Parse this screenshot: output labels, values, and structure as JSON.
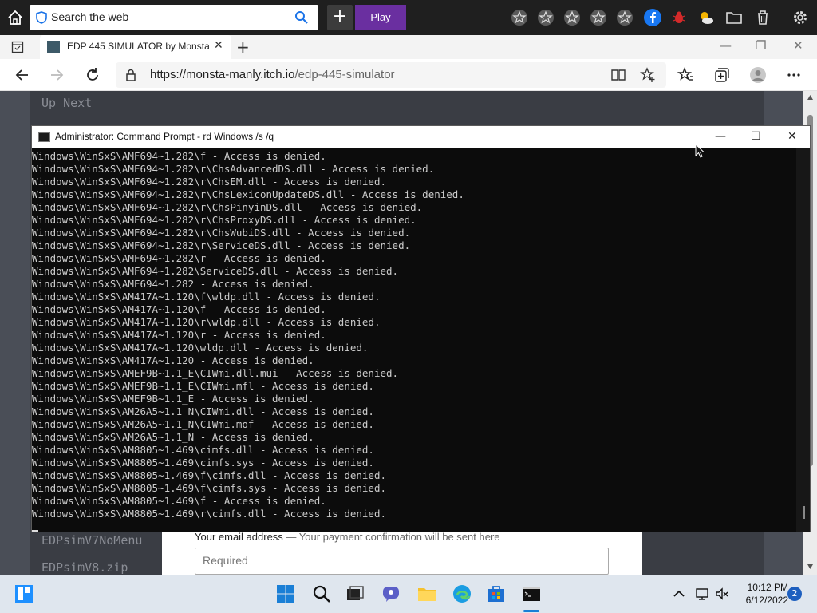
{
  "topbar": {
    "search_placeholder": "Search the web",
    "plus_label": "+",
    "play_label": "Play"
  },
  "browser": {
    "tab_title": "EDP 445 SIMULATOR by Monsta",
    "tab_close": "✕",
    "new_tab": "+",
    "window_minimize": "—",
    "window_restore": "❐",
    "window_close": "✕",
    "url_domain": "https://monsta-manly.itch.io",
    "url_path": "/edp-445-simulator"
  },
  "page": {
    "up_next": "Up Next",
    "file1": "EDPsimV7NoMenu",
    "file2": "EDPsimV8.zip",
    "email_label": "Your email address",
    "email_hint": " — Your payment confirmation will be sent here",
    "email_placeholder": "Required"
  },
  "cmd": {
    "title": "Administrator: Command Prompt - rd  Windows /s /q",
    "minimize": "—",
    "maximize": "☐",
    "close": "✕",
    "lines": [
      "Windows\\WinSxS\\AMF694~1.282\\f - Access is denied.",
      "Windows\\WinSxS\\AMF694~1.282\\r\\ChsAdvancedDS.dll - Access is denied.",
      "Windows\\WinSxS\\AMF694~1.282\\r\\ChsEM.dll - Access is denied.",
      "Windows\\WinSxS\\AMF694~1.282\\r\\ChsLexiconUpdateDS.dll - Access is denied.",
      "Windows\\WinSxS\\AMF694~1.282\\r\\ChsPinyinDS.dll - Access is denied.",
      "Windows\\WinSxS\\AMF694~1.282\\r\\ChsProxyDS.dll - Access is denied.",
      "Windows\\WinSxS\\AMF694~1.282\\r\\ChsWubiDS.dll - Access is denied.",
      "Windows\\WinSxS\\AMF694~1.282\\r\\ServiceDS.dll - Access is denied.",
      "Windows\\WinSxS\\AMF694~1.282\\r - Access is denied.",
      "Windows\\WinSxS\\AMF694~1.282\\ServiceDS.dll - Access is denied.",
      "Windows\\WinSxS\\AMF694~1.282 - Access is denied.",
      "Windows\\WinSxS\\AM417A~1.120\\f\\wldp.dll - Access is denied.",
      "Windows\\WinSxS\\AM417A~1.120\\f - Access is denied.",
      "Windows\\WinSxS\\AM417A~1.120\\r\\wldp.dll - Access is denied.",
      "Windows\\WinSxS\\AM417A~1.120\\r - Access is denied.",
      "Windows\\WinSxS\\AM417A~1.120\\wldp.dll - Access is denied.",
      "Windows\\WinSxS\\AM417A~1.120 - Access is denied.",
      "Windows\\WinSxS\\AMEF9B~1.1_E\\CIWmi.dll.mui - Access is denied.",
      "Windows\\WinSxS\\AMEF9B~1.1_E\\CIWmi.mfl - Access is denied.",
      "Windows\\WinSxS\\AMEF9B~1.1_E - Access is denied.",
      "Windows\\WinSxS\\AM26A5~1.1_N\\CIWmi.dll - Access is denied.",
      "Windows\\WinSxS\\AM26A5~1.1_N\\CIWmi.mof - Access is denied.",
      "Windows\\WinSxS\\AM26A5~1.1_N - Access is denied.",
      "Windows\\WinSxS\\AM8805~1.469\\cimfs.dll - Access is denied.",
      "Windows\\WinSxS\\AM8805~1.469\\cimfs.sys - Access is denied.",
      "Windows\\WinSxS\\AM8805~1.469\\f\\cimfs.dll - Access is denied.",
      "Windows\\WinSxS\\AM8805~1.469\\f\\cimfs.sys - Access is denied.",
      "Windows\\WinSxS\\AM8805~1.469\\f - Access is denied.",
      "Windows\\WinSxS\\AM8805~1.469\\r\\cimfs.dll - Access is denied."
    ]
  },
  "taskbar": {
    "time": "10:12 PM",
    "date": "6/12/2022",
    "notification_count": "2"
  }
}
